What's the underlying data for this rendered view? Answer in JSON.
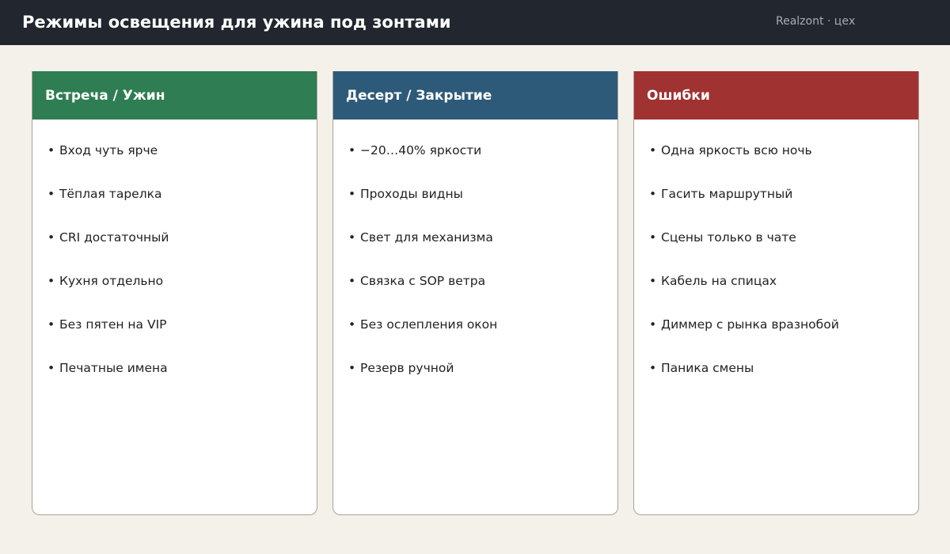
{
  "header": {
    "title": "Режимы освещения для ужина под зонтами",
    "brand": "Realzont · цех"
  },
  "colors": {
    "topbar": "#22262e",
    "background": "#f4f1ea",
    "card_green": "#2f7d52",
    "card_blue": "#2e5a7a",
    "card_red": "#a03232"
  },
  "bullet": "•",
  "cards": [
    {
      "title": "Встреча / Ужин",
      "color": "#2f7d52",
      "items": [
        "Вход чуть ярче",
        "Тёплая тарелка",
        "CRI достаточный",
        "Кухня отдельно",
        "Без пятен на VIP",
        "Печатные имена"
      ]
    },
    {
      "title": "Десерт / Закрытие",
      "color": "#2e5a7a",
      "items": [
        "−20…40% яркости",
        "Проходы видны",
        "Свет для механизма",
        "Связка с SOP ветра",
        "Без ослепления окон",
        "Резерв ручной"
      ]
    },
    {
      "title": "Ошибки",
      "color": "#a03232",
      "items": [
        "Одна яркость всю ночь",
        "Гасить маршрутный",
        "Сцены только в чате",
        "Кабель на спицах",
        "Диммер с рынка вразнобой",
        "Паника смены"
      ]
    }
  ]
}
